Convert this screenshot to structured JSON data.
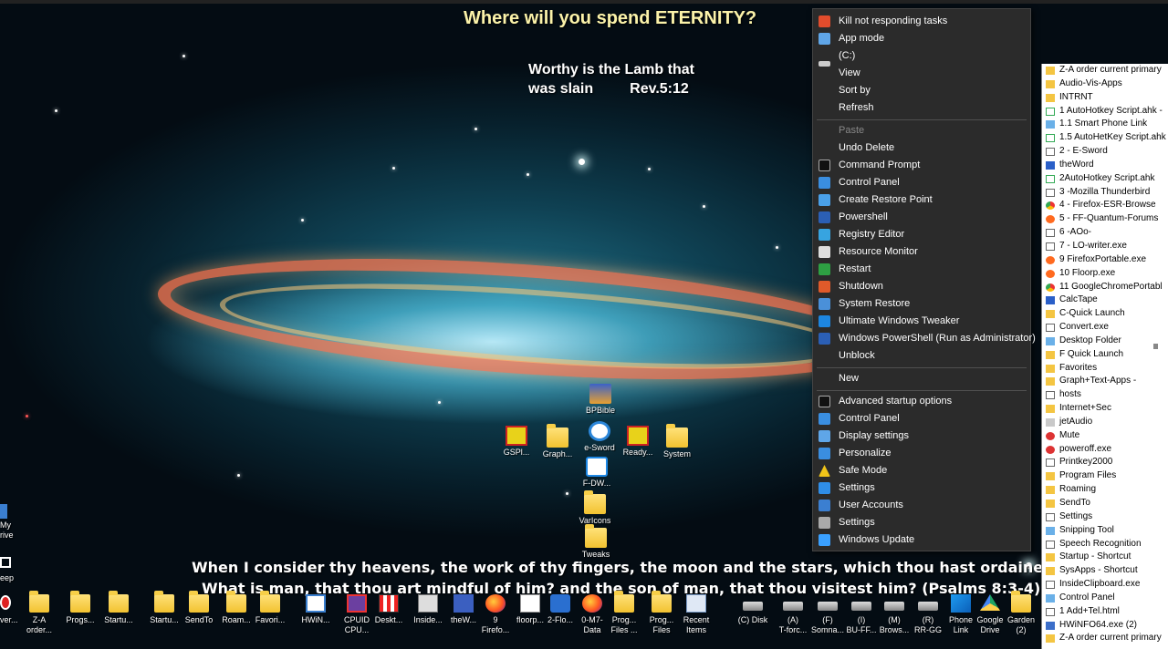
{
  "headline": "Where will you spend ETERNITY?",
  "verse_top": {
    "line1": "Worthy is the Lamb that",
    "line2": "was slain         Rev.5:12"
  },
  "verse_bottom": {
    "line1": "When I consider thy heavens, the work of thy fingers, the moon and the stars, which thou hast ordained;",
    "line2": "What is man, that thou art mindful of him? and the son of man, that thou visitest him? (Psalms 8:3-4)"
  },
  "desktop_icons": [
    {
      "label": "BPBible",
      "icon": "book-icon"
    },
    {
      "label": "GSPl...",
      "icon": "app-icon"
    },
    {
      "label": "Graph...",
      "icon": "folder-icon"
    },
    {
      "label": "e-Sword",
      "icon": "esword-icon"
    },
    {
      "label": "Ready...",
      "icon": "app-icon"
    },
    {
      "label": "System",
      "icon": "folder-icon"
    },
    {
      "label": "F-DW...",
      "icon": "download-icon"
    },
    {
      "label": "VarIcons",
      "icon": "folder-icon"
    },
    {
      "label": "Tweaks",
      "icon": "folder-icon"
    }
  ],
  "left_edge": {
    "my_drive": "My\nrive",
    "sleep": "eep",
    "power": "ver..."
  },
  "taskbar_icons": [
    {
      "label": "Z-A\norder...",
      "icon": "folder-check-icon"
    },
    {
      "label": "Progs...",
      "icon": "folder-icon"
    },
    {
      "label": "Startu...",
      "icon": "folder-icon"
    },
    {
      "label": "Startu...",
      "icon": "folder-icon"
    },
    {
      "label": "SendTo",
      "icon": "folder-icon"
    },
    {
      "label": "Roam...",
      "icon": "folder-icon"
    },
    {
      "label": "Favori...",
      "icon": "folder-icon"
    },
    {
      "label": "HWiN...",
      "icon": "hwinfo-icon"
    },
    {
      "label": "CPUID\nCPU...",
      "icon": "cpuid-icon"
    },
    {
      "label": "Deskt...",
      "icon": "grid-icon"
    },
    {
      "label": "Inside...",
      "icon": "inside-icon"
    },
    {
      "label": "theW...",
      "icon": "theword-icon"
    },
    {
      "label": "9\nFirefo...",
      "icon": "firefox-icon"
    },
    {
      "label": "floorp...",
      "icon": "file-icon"
    },
    {
      "label": "2-Flo...",
      "icon": "floorp-icon"
    },
    {
      "label": "0-M7-\nData",
      "icon": "firefox-icon"
    },
    {
      "label": "Prog...\nFiles ...",
      "icon": "folder-icon"
    },
    {
      "label": "Prog...\nFiles",
      "icon": "folder-icon"
    },
    {
      "label": "Recent\nItems",
      "icon": "recent-icon"
    },
    {
      "label": "(C) Disk",
      "icon": "drive-icon"
    },
    {
      "label": "(A)\nT-forc...",
      "icon": "drive-icon"
    },
    {
      "label": "(F)\nSomna...",
      "icon": "drive-icon"
    },
    {
      "label": "(I)\nBU-FF...",
      "icon": "drive-icon"
    },
    {
      "label": "(M)\nBrows...",
      "icon": "drive-icon"
    },
    {
      "label": "(R)\nRR-GG",
      "icon": "drive-icon"
    },
    {
      "label": "Phone\nLink",
      "icon": "phone-link-icon"
    },
    {
      "label": "Google\nDrive",
      "icon": "google-drive-icon"
    },
    {
      "label": "Garden\n(2)",
      "icon": "folder-icon"
    }
  ],
  "context_menu": {
    "group1": [
      {
        "label": "Kill not responding tasks",
        "icon": "kill-icon",
        "cls": "x"
      },
      {
        "label": "App mode",
        "icon": "monitor-icon",
        "cls": "mon"
      },
      {
        "label": "(C:)",
        "icon": "drive-icon",
        "cls": "drv"
      },
      {
        "label": "View",
        "icon": "",
        "cls": ""
      },
      {
        "label": "Sort by",
        "icon": "",
        "cls": ""
      },
      {
        "label": "Refresh",
        "icon": "",
        "cls": ""
      }
    ],
    "group2": [
      {
        "label": "Paste",
        "icon": "",
        "cls": "",
        "disabled": true
      },
      {
        "label": "Undo Delete",
        "icon": "",
        "cls": ""
      },
      {
        "label": "Command Prompt",
        "icon": "cmd-icon",
        "cls": "cmd"
      },
      {
        "label": "Control Panel",
        "icon": "control-panel-icon",
        "cls": "cp"
      },
      {
        "label": "Create Restore Point",
        "icon": "restore-point-icon",
        "cls": "rp"
      },
      {
        "label": "Powershell",
        "icon": "powershell-icon",
        "cls": "ps"
      },
      {
        "label": "Registry Editor",
        "icon": "registry-icon",
        "cls": "reg"
      },
      {
        "label": "Resource Monitor",
        "icon": "resource-monitor-icon",
        "cls": "res"
      },
      {
        "label": "Restart",
        "icon": "shield-green-icon",
        "cls": "shield-g"
      },
      {
        "label": "Shutdown",
        "icon": "shield-red-icon",
        "cls": "shield-r"
      },
      {
        "label": "System Restore",
        "icon": "system-restore-icon",
        "cls": "sr"
      },
      {
        "label": "Ultimate Windows Tweaker",
        "icon": "uwt-icon",
        "cls": "uwt"
      },
      {
        "label": "Windows PowerShell (Run as Administrator)",
        "icon": "powershell-icon",
        "cls": "ps"
      },
      {
        "label": "Unblock",
        "icon": "",
        "cls": ""
      }
    ],
    "group3": [
      {
        "label": "New",
        "icon": "",
        "cls": ""
      }
    ],
    "group4": [
      {
        "label": "Advanced startup options",
        "icon": "cmd-icon",
        "cls": "cmd"
      },
      {
        "label": "Control Panel",
        "icon": "control-panel-icon",
        "cls": "cp"
      },
      {
        "label": "Display settings",
        "icon": "display-icon",
        "cls": "mon"
      },
      {
        "label": "Personalize",
        "icon": "personalize-icon",
        "cls": "cp"
      },
      {
        "label": "Safe Mode",
        "icon": "warning-icon",
        "cls": "warn"
      },
      {
        "label": "Settings",
        "icon": "gear-icon",
        "cls": "gear"
      },
      {
        "label": "User Accounts",
        "icon": "user-icon",
        "cls": "user"
      },
      {
        "label": "Settings",
        "icon": "gear-icon",
        "cls": "gearg"
      },
      {
        "label": "Windows Update",
        "icon": "windows-update-icon",
        "cls": "winupd"
      }
    ]
  },
  "folder_list": [
    {
      "label": "Z-A order current primary",
      "cls": "fold"
    },
    {
      "label": "Audio-Vis-Apps",
      "cls": "fold"
    },
    {
      "label": "INTRNT",
      "cls": "fold"
    },
    {
      "label": "1 AutoHotkey Script.ahk -",
      "cls": "ahk"
    },
    {
      "label": "1.1 Smart Phone Link",
      "cls": "app"
    },
    {
      "label": "1.5 AutoHetKey Script.ahk",
      "cls": "ahk"
    },
    {
      "label": "2 - E-Sword",
      "cls": "doc"
    },
    {
      "label": "theWord",
      "cls": "blue"
    },
    {
      "label": "2AutoHotkey Script.ahk",
      "cls": "ahk"
    },
    {
      "label": "3 -Mozilla Thunderbird",
      "cls": "doc"
    },
    {
      "label": "4 - Firefox-ESR-Browse",
      "cls": "gc"
    },
    {
      "label": "5 - FF-Quantum-Forums",
      "cls": "ffx"
    },
    {
      "label": "6 -AOo-",
      "cls": "doc"
    },
    {
      "label": "7 - LO-writer.exe",
      "cls": "doc"
    },
    {
      "label": "9 FirefoxPortable.exe",
      "cls": "ffx"
    },
    {
      "label": "10  Floorp.exe",
      "cls": "ffx"
    },
    {
      "label": "11 GoogleChromePortabl",
      "cls": "gc"
    },
    {
      "label": "CalcTape",
      "cls": "blue"
    },
    {
      "label": "C-Quick Launch",
      "cls": "fold"
    },
    {
      "label": "Convert.exe",
      "cls": "doc"
    },
    {
      "label": "Desktop Folder",
      "cls": "app"
    },
    {
      "label": "F Quick Launch",
      "cls": "fold"
    },
    {
      "label": "Favorites",
      "cls": "fold"
    },
    {
      "label": "Graph+Text-Apps -",
      "cls": "fold"
    },
    {
      "label": "hosts",
      "cls": "doc"
    },
    {
      "label": "Internet+Sec",
      "cls": "fold"
    },
    {
      "label": "jetAudio",
      "cls": "cd"
    },
    {
      "label": "Mute",
      "cls": "red"
    },
    {
      "label": "poweroff.exe",
      "cls": "red"
    },
    {
      "label": "Printkey2000",
      "cls": "doc"
    },
    {
      "label": "Program Files",
      "cls": "fold"
    },
    {
      "label": "Roaming",
      "cls": "fold"
    },
    {
      "label": "SendTo",
      "cls": "fold"
    },
    {
      "label": "Settings",
      "cls": "doc"
    },
    {
      "label": "Snipping Tool",
      "cls": "app"
    },
    {
      "label": "Speech Recognition",
      "cls": "doc"
    },
    {
      "label": "Startup - Shortcut",
      "cls": "fold"
    },
    {
      "label": "SysApps - Shortcut",
      "cls": "fold"
    },
    {
      "label": "InsideClipboard.exe",
      "cls": "doc"
    },
    {
      "label": "Control Panel",
      "cls": "app"
    },
    {
      "label": "1 Add+Tel.html",
      "cls": "doc"
    },
    {
      "label": "HWiNFO64.exe (2)",
      "cls": "tb"
    },
    {
      "label": "Z-A order current primary",
      "cls": "fold"
    }
  ]
}
